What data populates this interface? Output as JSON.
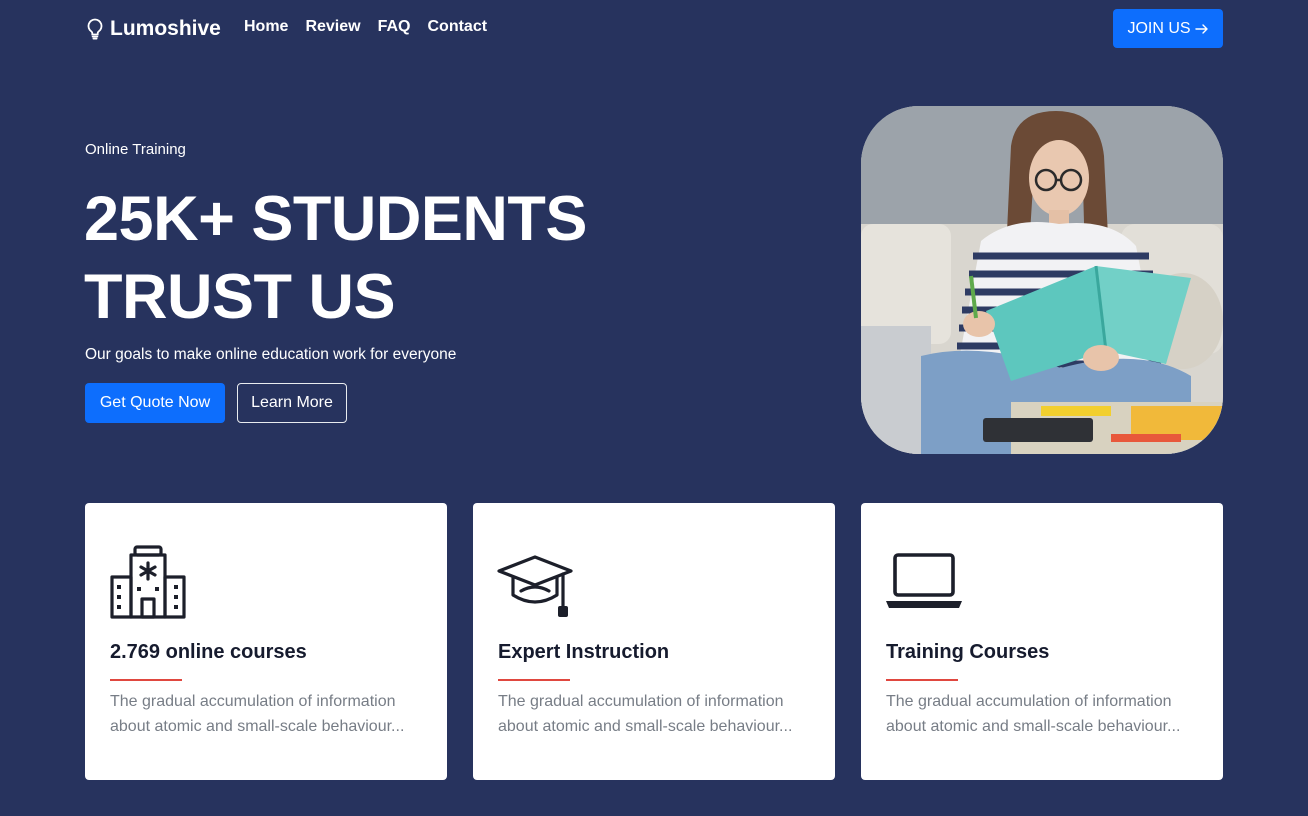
{
  "nav": {
    "brand": "Lumoshive",
    "links": [
      "Home",
      "Review",
      "FAQ",
      "Contact"
    ],
    "join_label": "JOIN US"
  },
  "hero": {
    "eyebrow": "Online Training",
    "headline_line1": "25K+ STUDENTS",
    "headline_line2": "TRUST US",
    "subline": "Our goals to make online education work for everyone",
    "primary_button": "Get Quote Now",
    "secondary_button": "Learn More"
  },
  "features": [
    {
      "icon": "building-icon",
      "title": "2.769 online courses",
      "text": "The gradual accumulation of information about atomic and small-scale behaviour..."
    },
    {
      "icon": "graduation-cap-icon",
      "title": "Expert Instruction",
      "text": "The gradual accumulation of information about atomic and small-scale behaviour..."
    },
    {
      "icon": "laptop-icon",
      "title": "Training Courses",
      "text": "The gradual accumulation of information about atomic and small-scale behaviour..."
    }
  ],
  "colors": {
    "background": "#27335e",
    "primary": "#0d6efd",
    "accent_rule": "#e0473f",
    "card": "#ffffff"
  }
}
